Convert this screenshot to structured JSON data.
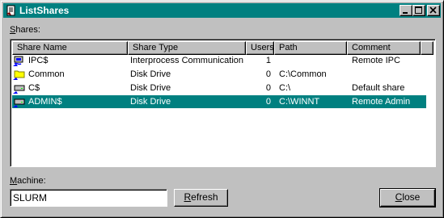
{
  "window": {
    "title": "ListShares"
  },
  "shares_label": "Shares:",
  "shares_label_prefix": "S",
  "shares_label_rest": "hares:",
  "columns": [
    "Share Name",
    "Share Type",
    "Users",
    "Path",
    "Comment"
  ],
  "rows": [
    {
      "name": "IPC$",
      "type": "Interprocess Communication",
      "users": "1",
      "path": "",
      "comment": "Remote IPC",
      "icon": "share-pipe-icon"
    },
    {
      "name": "Common",
      "type": "Disk Drive",
      "users": "0",
      "path": "C:\\Common",
      "comment": "",
      "icon": "shared-folder-icon"
    },
    {
      "name": "C$",
      "type": "Disk Drive",
      "users": "0",
      "path": "C:\\",
      "comment": "Default share",
      "icon": "shared-drive-icon"
    },
    {
      "name": "ADMIN$",
      "type": "Disk Drive",
      "users": "0",
      "path": "C:\\WINNT",
      "comment": "Remote Admin",
      "icon": "shared-drive-icon"
    }
  ],
  "selected_row": 3,
  "machine_label": "Machine:",
  "machine_label_prefix": "M",
  "machine_label_rest": "achine:",
  "machine_value": "SLURM",
  "refresh_label": "Refresh",
  "refresh_prefix": "R",
  "refresh_rest": "efresh",
  "close_label": "Close",
  "close_prefix": "C",
  "close_rest": "lose",
  "colors": {
    "titlebar": "#008080",
    "selection": "#008080",
    "face": "#c0c0c0"
  }
}
